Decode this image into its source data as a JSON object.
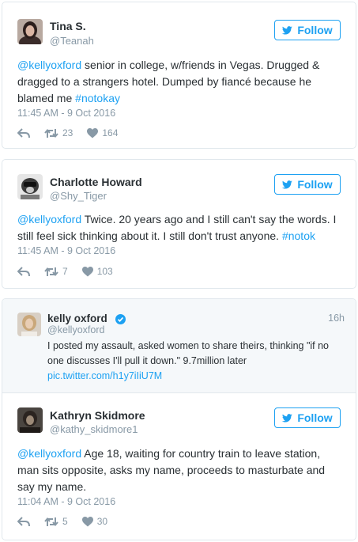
{
  "follow_label": "Follow",
  "colors": {
    "link": "#1da1f2",
    "text": "#292f33",
    "muted": "#8899a6",
    "border": "#e1e8ed"
  },
  "tweet1": {
    "name": "Tina S.",
    "handle": "@Teanah",
    "mention": "@kellyoxford",
    "text": " senior in college, w/friends in Vegas. Drugged & dragged to a strangers hotel. Dumped by fiancé because he blamed me ",
    "hashtag": "#notokay",
    "time": "11:45 AM - 9 Oct 2016",
    "retweets": "23",
    "likes": "164"
  },
  "tweet2": {
    "name": "Charlotte Howard",
    "handle": "@Shy_Tiger",
    "mention": "@kellyoxford",
    "text": " Twice. 20 years ago and I still can't say the words. I still feel sick thinking about it. I still don't trust anyone. ",
    "hashtag": "#notok",
    "time": "11:45 AM - 9 Oct 2016",
    "retweets": "7",
    "likes": "103"
  },
  "quoted": {
    "name": "kelly oxford",
    "handle": "@kellyoxford",
    "time": "16h",
    "text": "I posted my assault, asked women to share theirs, thinking \"if no one discusses I'll pull it down.\" 9.7million later",
    "link": "pic.twitter.com/h1y7iIiU7M"
  },
  "tweet3": {
    "name": "Kathryn Skidmore",
    "handle": "@kathy_skidmore1",
    "mention": "@kellyoxford",
    "text": " Age 18, waiting for country train to leave station, man sits opposite, asks my name, proceeds to masturbate and say my name.",
    "time": "11:04 AM - 9 Oct 2016",
    "retweets": "5",
    "likes": "30"
  }
}
